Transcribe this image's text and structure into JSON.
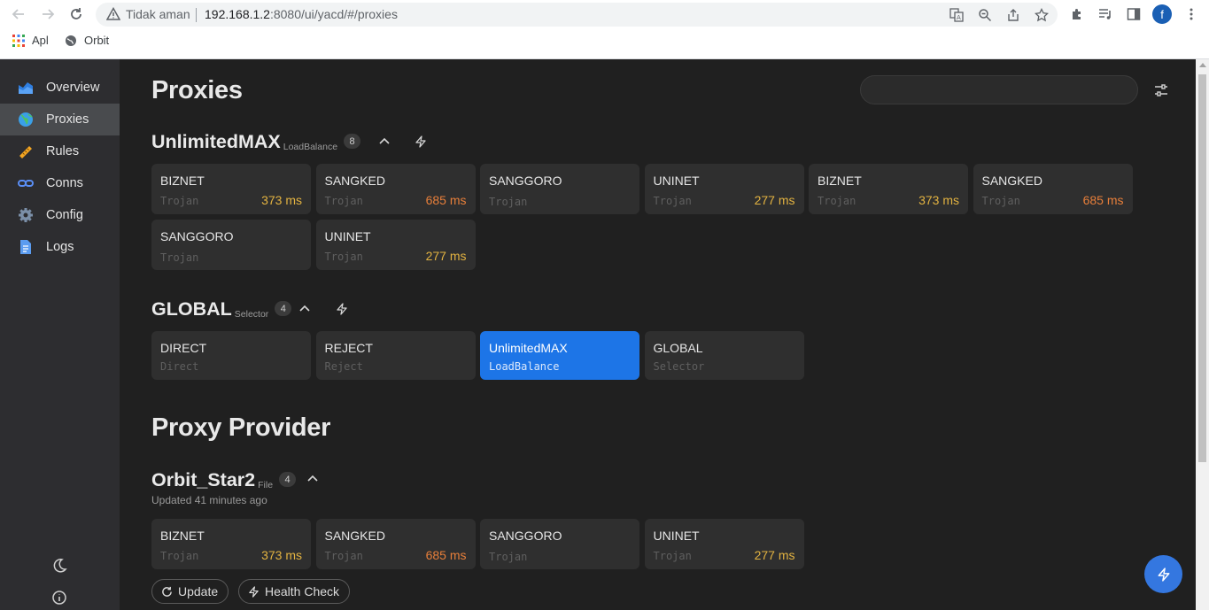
{
  "browser": {
    "security_label": "Tidak aman",
    "url_host": "192.168.1.2",
    "url_rest": ":8080/ui/yacd/#/proxies",
    "profile_initial": "f",
    "bookmarks": [
      "Apl",
      "Orbit"
    ]
  },
  "sidebar": {
    "items": [
      {
        "label": "Overview",
        "icon": "overview-icon"
      },
      {
        "label": "Proxies",
        "icon": "globe-icon"
      },
      {
        "label": "Rules",
        "icon": "ruler-icon"
      },
      {
        "label": "Conns",
        "icon": "link-icon"
      },
      {
        "label": "Config",
        "icon": "gear-icon"
      },
      {
        "label": "Logs",
        "icon": "document-icon"
      }
    ],
    "active": "Proxies",
    "bottom_icons": [
      "moon-icon",
      "info-icon"
    ]
  },
  "page": {
    "title": "Proxies",
    "search_placeholder": "",
    "provider_title": "Proxy Provider"
  },
  "groups": [
    {
      "name": "UnlimitedMAX",
      "type": "LoadBalance",
      "count": "8",
      "proxies": [
        {
          "name": "BIZNET",
          "type": "Trojan",
          "latency": "373 ms",
          "color": "#e3b341"
        },
        {
          "name": "SANGKED",
          "type": "Trojan",
          "latency": "685 ms",
          "color": "#e87f3a"
        },
        {
          "name": "SANGGORO",
          "type": "Trojan",
          "latency": "",
          "color": ""
        },
        {
          "name": "UNINET",
          "type": "Trojan",
          "latency": "277 ms",
          "color": "#e3b341"
        },
        {
          "name": "BIZNET",
          "type": "Trojan",
          "latency": "373 ms",
          "color": "#e3b341"
        },
        {
          "name": "SANGKED",
          "type": "Trojan",
          "latency": "685 ms",
          "color": "#e87f3a"
        },
        {
          "name": "SANGGORO",
          "type": "Trojan",
          "latency": "",
          "color": ""
        },
        {
          "name": "UNINET",
          "type": "Trojan",
          "latency": "277 ms",
          "color": "#e3b341"
        }
      ]
    },
    {
      "name": "GLOBAL",
      "type": "Selector",
      "count": "4",
      "proxies": [
        {
          "name": "DIRECT",
          "type": "Direct"
        },
        {
          "name": "REJECT",
          "type": "Reject"
        },
        {
          "name": "UnlimitedMAX",
          "type": "LoadBalance",
          "selected": true
        },
        {
          "name": "GLOBAL",
          "type": "Selector"
        }
      ]
    }
  ],
  "provider": {
    "name": "Orbit_Star2",
    "type": "File",
    "count": "4",
    "updated": "Updated 41 minutes ago",
    "proxies": [
      {
        "name": "BIZNET",
        "type": "Trojan",
        "latency": "373 ms",
        "color": "#e3b341"
      },
      {
        "name": "SANGKED",
        "type": "Trojan",
        "latency": "685 ms",
        "color": "#e87f3a"
      },
      {
        "name": "SANGGORO",
        "type": "Trojan",
        "latency": "",
        "color": ""
      },
      {
        "name": "UNINET",
        "type": "Trojan",
        "latency": "277 ms",
        "color": "#e3b341"
      }
    ],
    "update_label": "Update",
    "health_label": "Health Check"
  }
}
